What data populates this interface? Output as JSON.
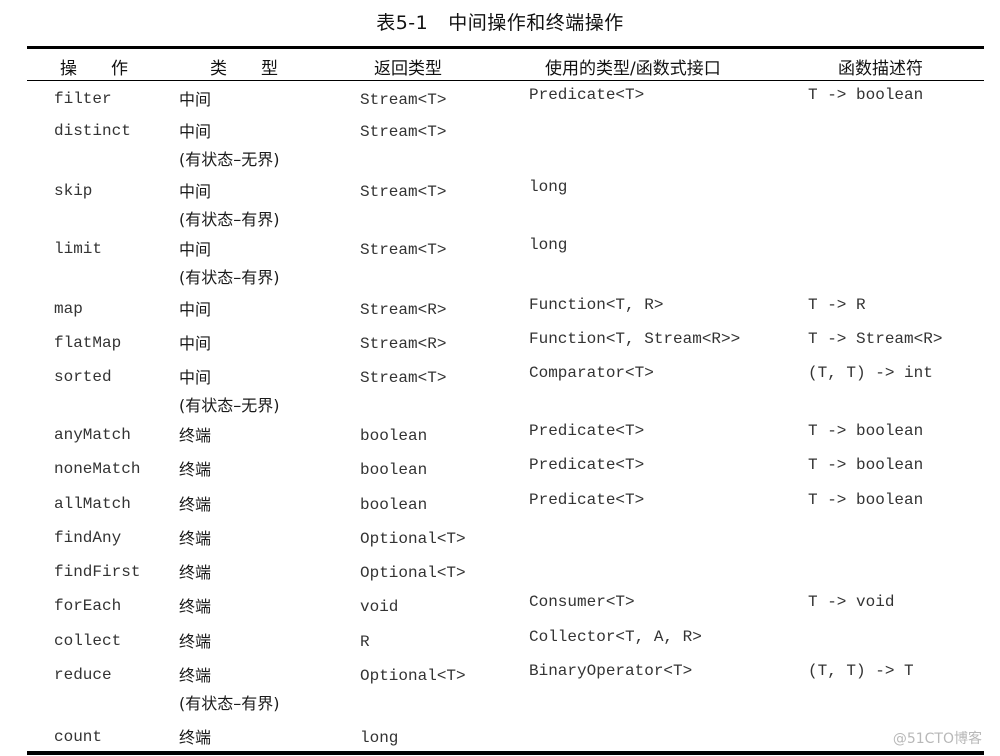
{
  "caption": {
    "number": "表5-1",
    "title": "中间操作和终端操作"
  },
  "headers": {
    "operation": "操　　作",
    "type": "类　　型",
    "return_type": "返回类型",
    "functional_interface": "使用的类型/函数式接口",
    "descriptor": "函数描述符"
  },
  "rows": [
    {
      "op": "filter",
      "type": "中间",
      "note": "",
      "ret": "Stream<T>",
      "iface": "Predicate<T>",
      "desc": "T -> boolean"
    },
    {
      "op": "distinct",
      "type": "中间",
      "note": "(有状态–无界)",
      "ret": "Stream<T>",
      "iface": "",
      "desc": ""
    },
    {
      "op": "skip",
      "type": "中间",
      "note": "(有状态–有界)",
      "ret": "Stream<T>",
      "iface": "long",
      "desc": ""
    },
    {
      "op": "limit",
      "type": "中间",
      "note": "(有状态–有界)",
      "ret": "Stream<T>",
      "iface": "long",
      "desc": ""
    },
    {
      "op": "map",
      "type": "中间",
      "note": "",
      "ret": "Stream<R>",
      "iface": "Function<T, R>",
      "desc": "T -> R"
    },
    {
      "op": "flatMap",
      "type": "中间",
      "note": "",
      "ret": "Stream<R>",
      "iface": "Function<T, Stream<R>>",
      "desc": "T -> Stream<R>"
    },
    {
      "op": "sorted",
      "type": "中间",
      "note": "(有状态–无界)",
      "ret": "Stream<T>",
      "iface": "Comparator<T>",
      "desc": "(T, T) -> int"
    },
    {
      "op": "anyMatch",
      "type": "终端",
      "note": "",
      "ret": "boolean",
      "iface": "Predicate<T>",
      "desc": "T -> boolean"
    },
    {
      "op": "noneMatch",
      "type": "终端",
      "note": "",
      "ret": "boolean",
      "iface": "Predicate<T>",
      "desc": "T -> boolean"
    },
    {
      "op": "allMatch",
      "type": "终端",
      "note": "",
      "ret": "boolean",
      "iface": "Predicate<T>",
      "desc": "T -> boolean"
    },
    {
      "op": "findAny",
      "type": "终端",
      "note": "",
      "ret": "Optional<T>",
      "iface": "",
      "desc": ""
    },
    {
      "op": "findFirst",
      "type": "终端",
      "note": "",
      "ret": "Optional<T>",
      "iface": "",
      "desc": ""
    },
    {
      "op": "forEach",
      "type": "终端",
      "note": "",
      "ret": "void",
      "iface": "Consumer<T>",
      "desc": "T -> void"
    },
    {
      "op": "collect",
      "type": "终端",
      "note": "",
      "ret": "R",
      "iface": "Collector<T, A, R>",
      "desc": ""
    },
    {
      "op": "reduce",
      "type": "终端",
      "note": "(有状态–有界)",
      "ret": "Optional<T>",
      "iface": "BinaryOperator<T>",
      "desc": "(T, T) -> T"
    },
    {
      "op": "count",
      "type": "终端",
      "note": "",
      "ret": "long",
      "iface": "",
      "desc": ""
    }
  ],
  "watermark": "@51CTO博客"
}
